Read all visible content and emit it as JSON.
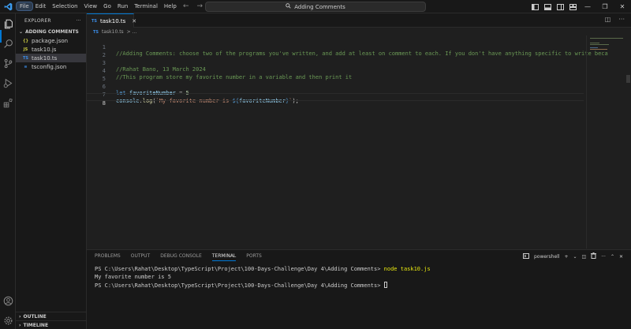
{
  "menu": [
    "File",
    "Edit",
    "Selection",
    "View",
    "Go",
    "Run",
    "Terminal",
    "Help"
  ],
  "search": {
    "label": "Adding Comments"
  },
  "sidebar": {
    "header": "EXPLORER",
    "section": "ADDING COMMENTS",
    "files": [
      {
        "icon": "{}",
        "name": "package.json"
      },
      {
        "icon": "JS",
        "name": "task10.js"
      },
      {
        "icon": "TS",
        "name": "task10.ts"
      },
      {
        "icon": "≡",
        "name": "tsconfig.json"
      }
    ],
    "outline": "OUTLINE",
    "timeline": "TIMELINE"
  },
  "tab": {
    "icon": "TS",
    "label": "task10.ts"
  },
  "breadcrumb": {
    "icon": "TS",
    "file": "task10.ts",
    "sep": "> ..."
  },
  "editor": {
    "lines": [
      {
        "n": "1",
        "comment": "//Adding Comments: choose two of the programs you've written, and add at least on comment to each. If you don't have anything specific to write beca"
      },
      {
        "n": "2"
      },
      {
        "n": "3",
        "comment": "//Rahat Bano, 13 March 2024"
      },
      {
        "n": "4",
        "comment": "//This program store my favorite number in a variable and then print it"
      },
      {
        "n": "5"
      },
      {
        "n": "6",
        "kw": "let",
        "var": "favoriteNumber",
        "op": " = ",
        "num": "5"
      },
      {
        "n": "7",
        "obj": "console",
        "dot": ".",
        "fn": "log",
        "open": "(",
        "str1": "`My favorite number is ",
        "tpl_open": "${",
        "tpl_var": "favoriteNumber",
        "tpl_close": "}",
        "str2": "`",
        "close": ");"
      },
      {
        "n": "8"
      }
    ]
  },
  "panel": {
    "tabs": [
      "PROBLEMS",
      "OUTPUT",
      "DEBUG CONSOLE",
      "TERMINAL",
      "PORTS"
    ],
    "shell": "powershell",
    "terminal": {
      "line1_prompt": "PS C:\\Users\\Rahat\\Desktop\\TypeScript\\Project\\100-Days-Challenge\\Day 4\\Adding Comments> ",
      "line1_cmd": "node task10.js",
      "line2": "My favorite number is 5",
      "line3_prompt": "PS C:\\Users\\Rahat\\Desktop\\TypeScript\\Project\\100-Days-Challenge\\Day 4\\Adding Comments> "
    }
  }
}
